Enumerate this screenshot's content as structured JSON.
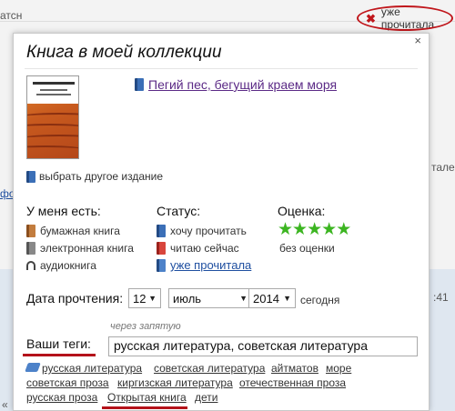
{
  "background": {
    "left_fragment_1": "атсн",
    "left_fragment_2": "фо",
    "right_fragment_1": "тале",
    "right_fragment_2": ":41",
    "left_fragment_3": "«"
  },
  "top_status": {
    "label": "уже прочитала",
    "icon": "close-x-icon",
    "accent": "#c0161b"
  },
  "dialog": {
    "title": "Книга в моей коллекции",
    "close": "×",
    "book_title": "Пегий пес, бегущий краем моря",
    "change_edition": "выбрать другое издание",
    "have": {
      "heading": "У меня есть:",
      "items": [
        "бумажная книга",
        "электронная книга",
        "аудиокнига"
      ]
    },
    "status": {
      "heading": "Статус:",
      "items": [
        "хочу прочитать",
        "читаю сейчас",
        "уже прочитала"
      ]
    },
    "rating": {
      "heading": "Оценка:",
      "stars": 5,
      "note": "без оценки",
      "star_color": "#3cb521"
    },
    "read_date": {
      "label": "Дата прочтения:",
      "day": "12",
      "month": "июль",
      "year": "2014",
      "today": "сегодня"
    },
    "tags": {
      "label": "Ваши теги:",
      "hint": "через запятую",
      "value": "русская литература, советская литература",
      "suggestions": [
        "русская литература",
        "советская литература",
        "айтматов",
        "море",
        "советская проза",
        "киргизская литература",
        "отечественная проза",
        "русская проза",
        "Открытая книга",
        "дети"
      ]
    }
  }
}
